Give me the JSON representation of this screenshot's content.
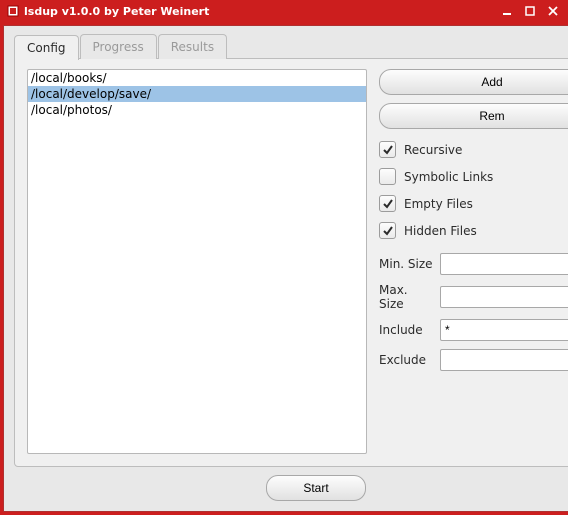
{
  "window": {
    "title": "lsdup v1.0.0 by Peter Weinert"
  },
  "tabs": {
    "config": "Config",
    "progress": "Progress",
    "results": "Results",
    "active": "config"
  },
  "paths": [
    "/local/books/",
    "/local/develop/save/",
    "/local/photos/"
  ],
  "selected_path_index": 1,
  "buttons": {
    "add": "Add",
    "rem": "Rem",
    "start": "Start"
  },
  "options": {
    "recursive": {
      "label": "Recursive",
      "checked": true
    },
    "symlinks": {
      "label": "Symbolic Links",
      "checked": false
    },
    "empty": {
      "label": "Empty Files",
      "checked": true
    },
    "hidden": {
      "label": "Hidden Files",
      "checked": true
    }
  },
  "fields": {
    "min_size": {
      "label": "Min. Size",
      "value": ""
    },
    "max_size": {
      "label": "Max. Size",
      "value": ""
    },
    "include": {
      "label": "Include",
      "value": "*"
    },
    "exclude": {
      "label": "Exclude",
      "value": ""
    }
  }
}
